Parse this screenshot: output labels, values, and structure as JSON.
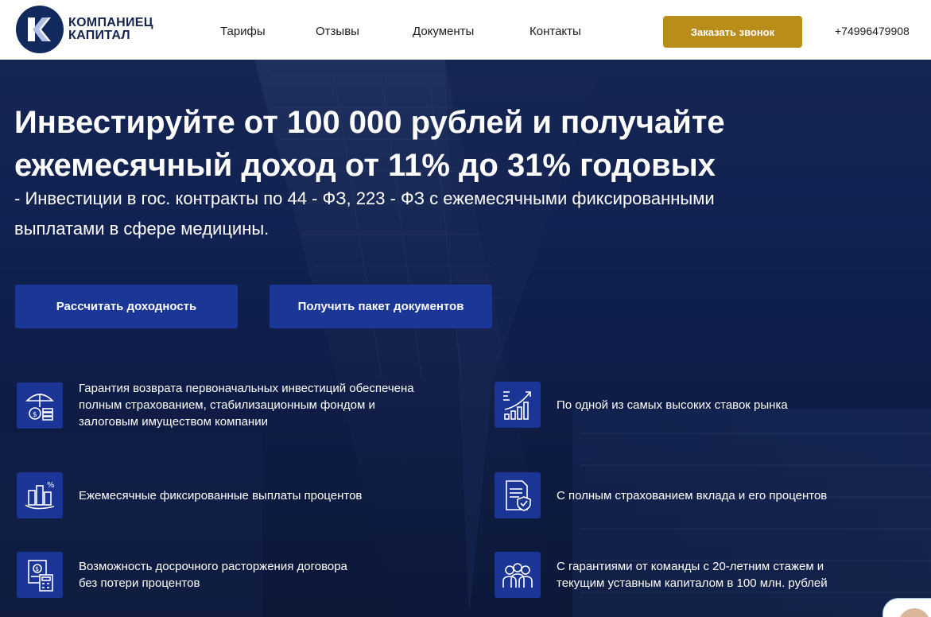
{
  "header": {
    "logo_line1": "КОМПАНИЕЦ",
    "logo_line2": "КАПИТАЛ",
    "nav": [
      "Тарифы",
      "Отзывы",
      "Документы",
      "Контакты"
    ],
    "cta_label": "Заказать звонок",
    "phone": "+74996479908"
  },
  "hero": {
    "title_line1": "Инвестируйте от 100 000 рублей и получайте",
    "title_line2": "ежемесячный доход от 11% до 31% годовых",
    "subtitle_line1": "- Инвестиции в гос. контракты по 44 - ФЗ, 223 - ФЗ с ежемесячными фиксированными",
    "subtitle_line2": "выплатами в сфере медицины.",
    "button_calc": "Рассчитать доходность",
    "button_docs": "Получить пакет документов"
  },
  "features": [
    {
      "icon": "umbrella-money-icon",
      "line1": "Гарантия возврата первоначальных инвестиций обеспечена",
      "line2": "полным страхованием, стабилизационным фондом и",
      "line3": "залоговым имуществом компании"
    },
    {
      "icon": "growth-chart-icon",
      "line1": "По одной из самых высоких ставок рынка"
    },
    {
      "icon": "percent-building-icon",
      "line1": "Ежемесячные фиксированные выплаты процентов"
    },
    {
      "icon": "insured-document-icon",
      "line1": "С полным страхованием вклада и его процентов"
    },
    {
      "icon": "calculator-document-icon",
      "line1": "Возможность досрочного расторжения договора",
      "line2": "без потери процентов"
    },
    {
      "icon": "team-icon",
      "line1": "С гарантиями от команды с 20-летним стажем и",
      "line2": "текущим уставным капиталом в 100 млн. рублей"
    }
  ],
  "colors": {
    "brand_dark": "#12295e",
    "accent_gold": "#b98d1a",
    "button_blue": "#1a3697"
  }
}
